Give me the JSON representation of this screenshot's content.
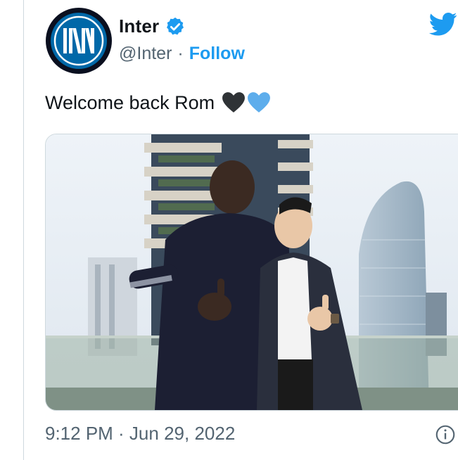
{
  "tweet": {
    "display_name": "Inter",
    "handle": "@Inter",
    "separator": "·",
    "follow_label": "Follow",
    "text": "Welcome back Rom",
    "emojis": [
      "black-heart",
      "blue-heart"
    ],
    "timestamp": "9:12 PM · Jun 29, 2022"
  },
  "avatar": {
    "logo_text": "IM"
  },
  "colors": {
    "accent": "#1d9bf0",
    "text_primary": "#0f1419",
    "text_secondary": "#536471",
    "border": "#cfd9de",
    "inter_blue": "#0068a8",
    "inter_navy": "#101c3e"
  },
  "icons": [
    "inter-logo",
    "verified-badge-icon",
    "twitter-bird-icon",
    "black-heart-icon",
    "blue-heart-icon",
    "info-icon"
  ]
}
